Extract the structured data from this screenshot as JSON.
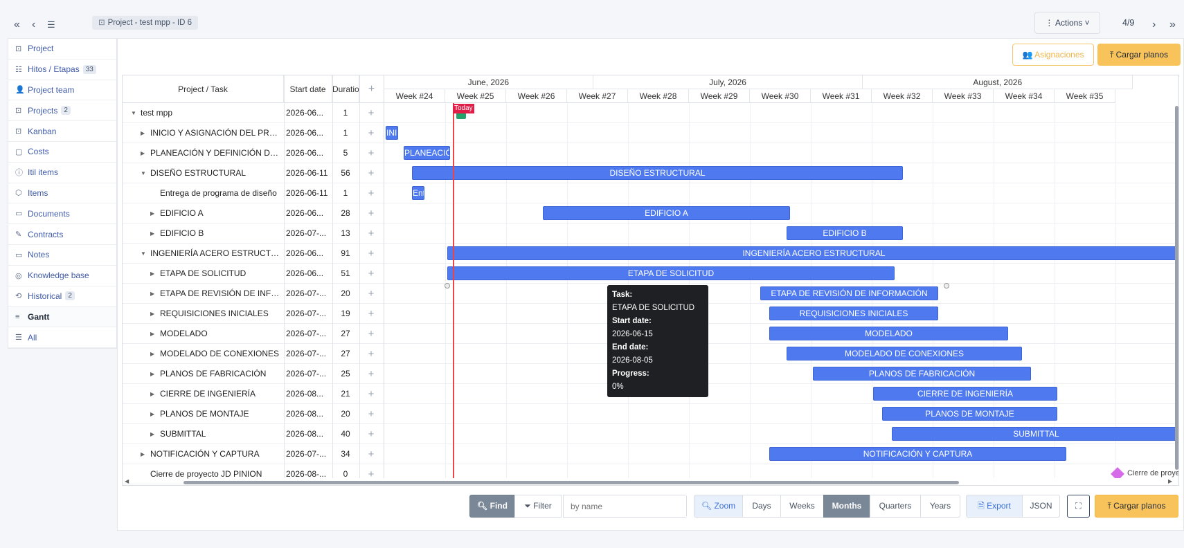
{
  "nav": {
    "crumb": "Project -  test mpp - ID 6",
    "actions": "Actions",
    "pager": "4/9"
  },
  "sidebar": [
    {
      "label": "Project",
      "icon": "project-icon"
    },
    {
      "label": "Hitos / Etapas",
      "badge": "33",
      "icon": "list-icon"
    },
    {
      "label": "Project team",
      "icon": "team-icon"
    },
    {
      "label": "Projects",
      "badge": "2",
      "icon": "project-icon"
    },
    {
      "label": "Kanban",
      "icon": "kanban-icon"
    },
    {
      "label": "Costs",
      "icon": "costs-icon"
    },
    {
      "label": "Itil items",
      "icon": "info-icon"
    },
    {
      "label": "Items",
      "icon": "box-icon"
    },
    {
      "label": "Documents",
      "icon": "document-icon"
    },
    {
      "label": "Contracts",
      "icon": "contract-icon"
    },
    {
      "label": "Notes",
      "icon": "note-icon"
    },
    {
      "label": "Knowledge base",
      "icon": "knowledge-icon"
    },
    {
      "label": "Historical",
      "badge": "2",
      "icon": "history-icon"
    },
    {
      "label": "Gantt",
      "icon": "gantt-icon",
      "active": true
    },
    {
      "label": "All",
      "icon": "all-icon"
    }
  ],
  "buttons": {
    "asignaciones": "Asignaciones",
    "cargar_planos": "Cargar planos"
  },
  "grid": {
    "col_task": "Project / Task",
    "col_start": "Start date",
    "col_duration": "Duratio",
    "col_add": "+"
  },
  "scale": {
    "months": [
      "June, 2026",
      "July, 2026",
      "August, 2026"
    ],
    "weeks": [
      "Week #24",
      "Week #25",
      "Week #26",
      "Week #27",
      "Week #28",
      "Week #29",
      "Week #30",
      "Week #31",
      "Week #32",
      "Week #33",
      "Week #34",
      "Week #35"
    ]
  },
  "today_label": "Today",
  "tasks": [
    {
      "name": "test mpp",
      "start": "2026-06...",
      "duration": "1",
      "level": 0,
      "caret": "down"
    },
    {
      "name": "INICIO Y ASIGNACIÓN DEL PROYECTO",
      "start": "2026-06...",
      "duration": "1",
      "level": 1,
      "caret": "right",
      "bar_label": "INICIO Y ASIGNACIÓN DEL PROYECTO"
    },
    {
      "name": "PLANEACIÓN Y DEFINICIÓN DE ALCANCE",
      "start": "2026-06...",
      "duration": "5",
      "level": 1,
      "caret": "right",
      "bar_label": "PLANEACIÓN Y DEFINICIÓN DE ALCANCE"
    },
    {
      "name": "DISEÑO ESTRUCTURAL",
      "start": "2026-06-11",
      "duration": "56",
      "level": 1,
      "caret": "down",
      "bar_label": "DISEÑO ESTRUCTURAL"
    },
    {
      "name": "Entrega de programa de diseño",
      "start": "2026-06-11",
      "duration": "1",
      "level": 2,
      "caret": "",
      "bar_label": "Entrega de programa de diseño"
    },
    {
      "name": "EDIFICIO A",
      "start": "2026-06...",
      "duration": "28",
      "level": 2,
      "caret": "right",
      "bar_label": "EDIFICIO A"
    },
    {
      "name": "EDIFICIO B",
      "start": "2026-07-...",
      "duration": "13",
      "level": 2,
      "caret": "right",
      "bar_label": "EDIFICIO B"
    },
    {
      "name": "INGENIERÍA ACERO ESTRUCTURAL",
      "start": "2026-06...",
      "duration": "91",
      "level": 1,
      "caret": "down",
      "bar_label": "INGENIERÍA ACERO ESTRUCTURAL"
    },
    {
      "name": "ETAPA DE SOLICITUD",
      "start": "2026-06...",
      "duration": "51",
      "level": 2,
      "caret": "right",
      "bar_label": "ETAPA DE SOLICITUD"
    },
    {
      "name": "ETAPA DE REVISIÓN DE INFORMACIÓN",
      "start": "2026-07-...",
      "duration": "20",
      "level": 2,
      "caret": "right",
      "bar_label": "ETAPA DE REVISIÓN DE INFORMACIÓN"
    },
    {
      "name": "REQUISICIONES INICIALES",
      "start": "2026-07-...",
      "duration": "19",
      "level": 2,
      "caret": "right",
      "bar_label": "REQUISICIONES INICIALES"
    },
    {
      "name": "MODELADO",
      "start": "2026-07-...",
      "duration": "27",
      "level": 2,
      "caret": "right",
      "bar_label": "MODELADO"
    },
    {
      "name": "MODELADO DE CONEXIONES",
      "start": "2026-07-...",
      "duration": "27",
      "level": 2,
      "caret": "right",
      "bar_label": "MODELADO DE CONEXIONES"
    },
    {
      "name": "PLANOS DE FABRICACIÓN",
      "start": "2026-07-...",
      "duration": "25",
      "level": 2,
      "caret": "right",
      "bar_label": "PLANOS DE FABRICACIÓN"
    },
    {
      "name": "CIERRE DE INGENIERÍA",
      "start": "2026-08...",
      "duration": "21",
      "level": 2,
      "caret": "right",
      "bar_label": "CIERRE DE INGENIERÍA"
    },
    {
      "name": "PLANOS DE MONTAJE",
      "start": "2026-08...",
      "duration": "20",
      "level": 2,
      "caret": "right",
      "bar_label": "PLANOS DE MONTAJE"
    },
    {
      "name": "SUBMITTAL",
      "start": "2026-08...",
      "duration": "40",
      "level": 2,
      "caret": "right",
      "bar_label": "SUBMITTAL"
    },
    {
      "name": "NOTIFICACIÓN Y CAPTURA",
      "start": "2026-07-...",
      "duration": "34",
      "level": 1,
      "caret": "right",
      "bar_label": "NOTIFICACIÓN Y CAPTURA"
    },
    {
      "name": "Cierre de proyecto JD PINION",
      "start": "2026-08-...",
      "duration": "0",
      "level": 1,
      "caret": "",
      "bar_label": "Cierre de proyecto JD PINION"
    }
  ],
  "tooltip": {
    "task_label": "Task:",
    "task": "ETAPA DE SOLICITUD",
    "start_label": "Start date:",
    "start": "2026-06-15",
    "end_label": "End date:",
    "end": "2026-08-05",
    "progress_label": "Progress:",
    "progress": "0%"
  },
  "toolbar": {
    "find": "Find",
    "filter": "Filter",
    "search_placeholder": "by name",
    "zoom": "Zoom",
    "days": "Days",
    "weeks": "Weeks",
    "months": "Months",
    "quarters": "Quarters",
    "years": "Years",
    "export": "Export",
    "json": "JSON",
    "cargar_planos": "Cargar planos"
  }
}
